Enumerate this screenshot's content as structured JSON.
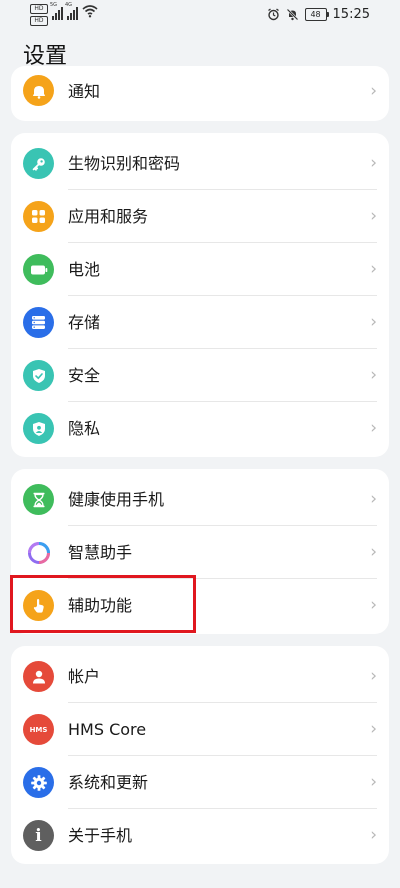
{
  "status_bar": {
    "hd_badges": [
      "HD",
      "HD"
    ],
    "signal_tags": [
      "5G",
      "4G"
    ],
    "battery": "48",
    "time": "15:25"
  },
  "header": {
    "title": "设置"
  },
  "groups": [
    {
      "items": [
        {
          "label": "通知",
          "icon": "bell-icon",
          "color": "#f5a31a"
        }
      ]
    },
    {
      "items": [
        {
          "label": "生物识别和密码",
          "icon": "key-icon",
          "color": "#39c4b3"
        },
        {
          "label": "应用和服务",
          "icon": "apps-grid-icon",
          "color": "#f5a31a"
        },
        {
          "label": "电池",
          "icon": "battery-icon",
          "color": "#3fbc5c"
        },
        {
          "label": "存储",
          "icon": "storage-icon",
          "color": "#2a6ee8"
        },
        {
          "label": "安全",
          "icon": "shield-icon",
          "color": "#39c4b3"
        },
        {
          "label": "隐私",
          "icon": "privacy-icon",
          "color": "#39c4b3"
        }
      ]
    },
    {
      "items": [
        {
          "label": "健康使用手机",
          "icon": "hourglass-icon",
          "color": "#3fbc5c"
        },
        {
          "label": "智慧助手",
          "icon": "assistant-ring-icon",
          "color": "#8f6cf0"
        },
        {
          "label": "辅助功能",
          "icon": "hand-tap-icon",
          "color": "#f5a31a"
        }
      ]
    },
    {
      "items": [
        {
          "label": "帐户",
          "icon": "user-icon",
          "color": "#e54a3a"
        },
        {
          "label": "HMS Core",
          "icon": "hms-icon",
          "color": "#e54a3a",
          "icon_text": "HMS"
        },
        {
          "label": "系统和更新",
          "icon": "gear-icon",
          "color": "#2a6ee8"
        },
        {
          "label": "关于手机",
          "icon": "info-icon",
          "color": "#5f5f5f",
          "icon_text": "i"
        }
      ]
    }
  ]
}
